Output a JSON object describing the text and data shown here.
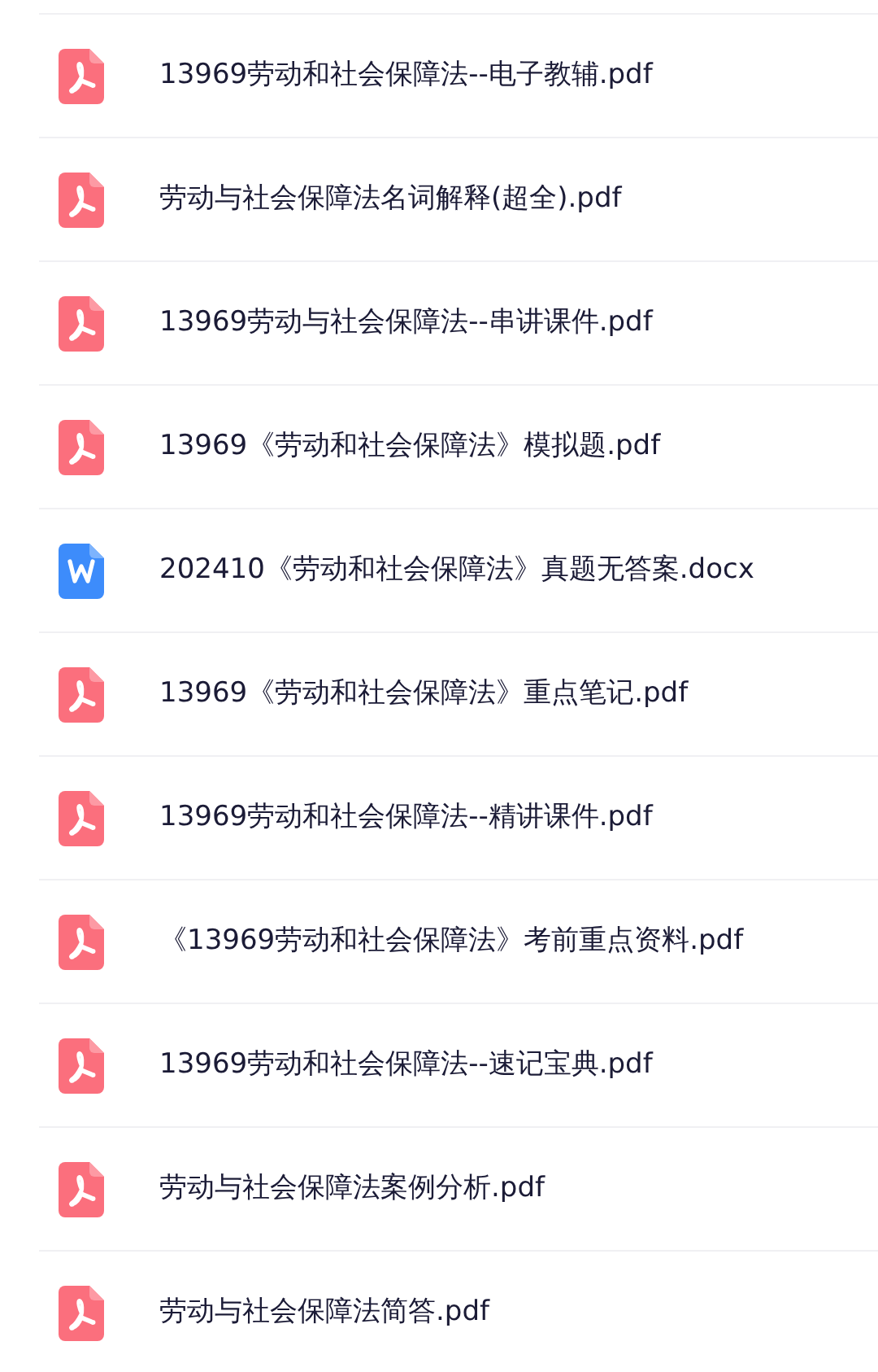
{
  "files": [
    {
      "name": "13969劳动和社会保障法--电子教辅.pdf",
      "kind": "pdf"
    },
    {
      "name": "劳动与社会保障法名词解释(超全).pdf",
      "kind": "pdf"
    },
    {
      "name": "13969劳动与社会保障法--串讲课件.pdf",
      "kind": "pdf"
    },
    {
      "name": "13969《劳动和社会保障法》模拟题.pdf",
      "kind": "pdf"
    },
    {
      "name": "202410《劳动和社会保障法》真题无答案.docx",
      "kind": "word"
    },
    {
      "name": "13969《劳动和社会保障法》重点笔记.pdf",
      "kind": "pdf"
    },
    {
      "name": "13969劳动和社会保障法--精讲课件.pdf",
      "kind": "pdf"
    },
    {
      "name": "《13969劳动和社会保障法》考前重点资料.pdf",
      "kind": "pdf"
    },
    {
      "name": "13969劳动和社会保障法--速记宝典.pdf",
      "kind": "pdf"
    },
    {
      "name": "劳动与社会保障法案例分析.pdf",
      "kind": "pdf"
    },
    {
      "name": "劳动与社会保障法简答.pdf",
      "kind": "pdf"
    }
  ]
}
